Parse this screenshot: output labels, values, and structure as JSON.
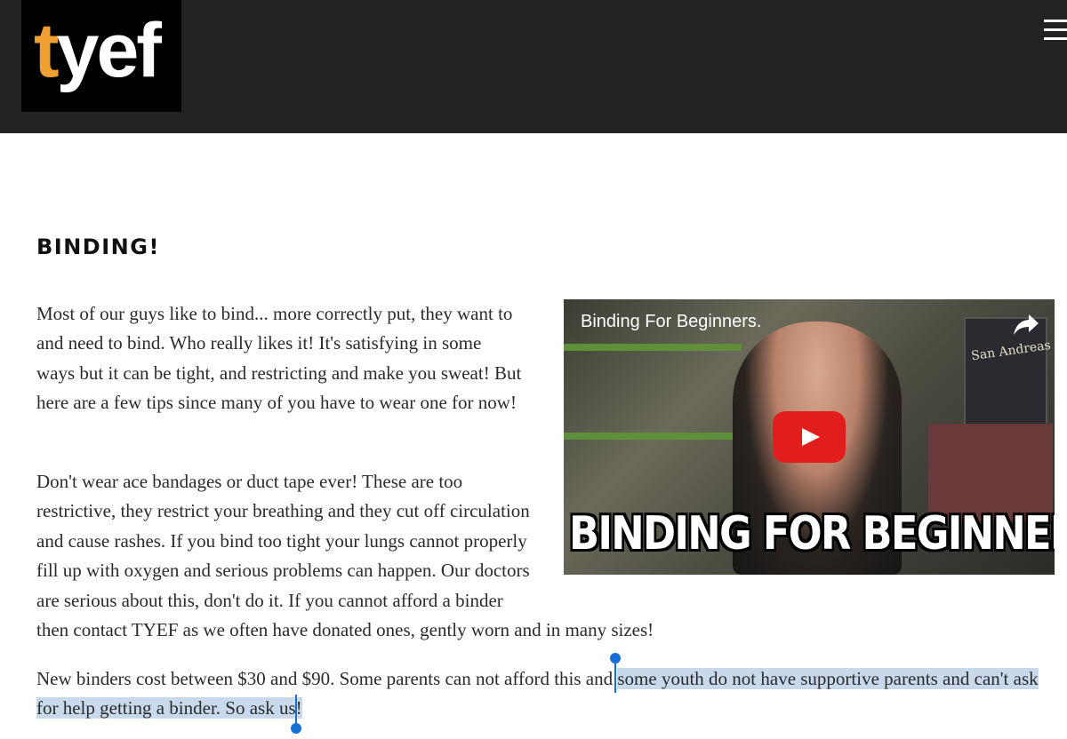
{
  "header": {
    "logo_prefix": "t",
    "logo_rest": "yef",
    "logo_accent_color": "#f0a030",
    "menu_icon": "hamburger-menu-icon"
  },
  "main": {
    "title": "BINDING!",
    "paragraph1": "Most of our guys like to bind... more correctly put, they want to and need to bind. Who really likes it! It's satisfying in some ways but it can be tight, and restricting and make you sweat! But here are a few tips since many of you have to wear one for now!",
    "paragraph2_narrow": "Don't wear ace bandages or duct tape ever! These are too restrictive, they restrict your breathing and they cut off circulation and cause rashes. If you bind too tight your lungs cannot properly fill up with oxygen and serious problems can happen. Our doctors are serious about this, don't do it. If you cannot afford a binder",
    "paragraph2_wide": "then contact TYEF as we often have donated ones, gently worn and in many sizes!",
    "paragraph3_before": "New binders cost between $30 and $90. Some parents can not afford this and ",
    "paragraph3_selected": "some youth do not have supportive parents and can't ask for help getting a binder. So ask us!"
  },
  "video": {
    "title": "Binding For Beginners.",
    "caption": "BINDING FOR BEGINNERS",
    "poster_text": "San Andreas",
    "share_icon": "share-arrow-icon",
    "play_icon": "play-icon",
    "play_color": "#e11d1d"
  },
  "colors": {
    "header_bg": "#232323",
    "selection": "#c8d9ec",
    "selection_handle": "#1570d6"
  }
}
